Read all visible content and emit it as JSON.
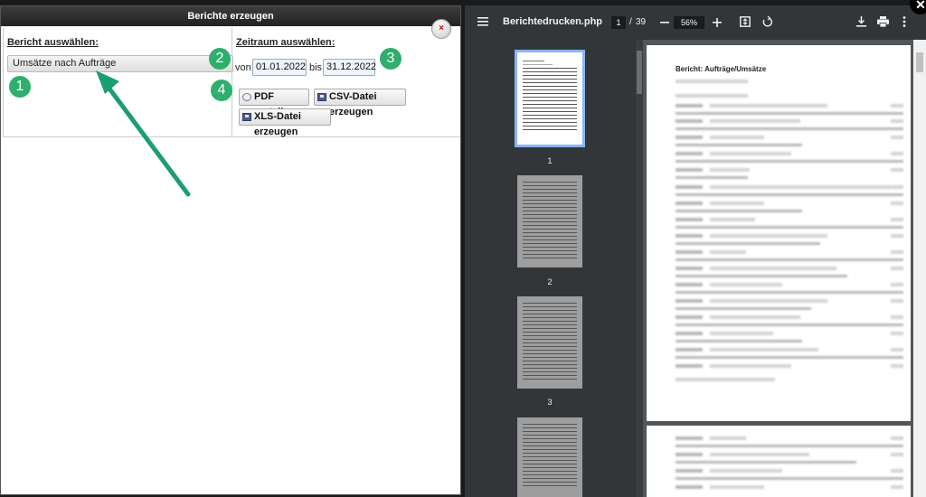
{
  "dialog": {
    "title": "Berichte erzeugen",
    "close_label": "×",
    "report_section_title": "Bericht auswählen:",
    "report_selected": "Umsätze nach Aufträge",
    "period_section_title": "Zeitraum auswählen:",
    "from_label": "von:",
    "from_value": "01.01.2022",
    "to_label": "bis:",
    "to_value": "31.12.2022",
    "buttons": {
      "pdf": "PDF erstellen",
      "csv": "CSV-Datei erzeugen",
      "xls": "XLS-Datei erzeugen"
    }
  },
  "badges": [
    "1",
    "2",
    "3",
    "4"
  ],
  "annotation": {
    "arrow_color": "#1b9e73",
    "badge_color": "#2fae6d"
  },
  "viewer": {
    "filename": "Berichtedrucken.php",
    "current_page": "1",
    "page_separator": "/",
    "total_pages": "39",
    "zoom": "56%",
    "thumbnails": [
      "1",
      "2",
      "3"
    ],
    "document_heading": "Bericht: Aufträge/Umsätze",
    "icons": [
      "menu-icon",
      "zoom-out-icon",
      "zoom-in-icon",
      "fit-page-icon",
      "rotate-icon",
      "download-icon",
      "print-icon",
      "more-icon"
    ]
  },
  "window": {
    "close_label": "✕"
  }
}
